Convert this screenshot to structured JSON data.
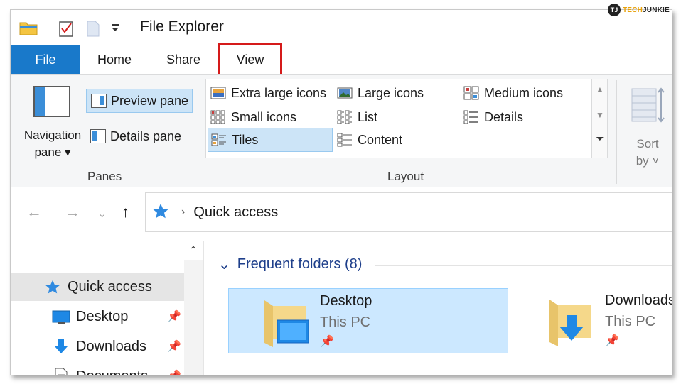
{
  "watermark": {
    "mark": "TJ",
    "brand_pre": "TECH",
    "brand_post": "JUNKIE"
  },
  "window": {
    "title": "File Explorer"
  },
  "tabs": {
    "file": "File",
    "home": "Home",
    "share": "Share",
    "view": "View"
  },
  "ribbon": {
    "panes": {
      "navigation_pane_line1": "Navigation",
      "navigation_pane_line2": "pane ▾",
      "preview_pane": "Preview pane",
      "details_pane": "Details pane",
      "group_label": "Panes"
    },
    "layout": {
      "extra_large_icons": "Extra large icons",
      "large_icons": "Large icons",
      "medium_icons": "Medium icons",
      "small_icons": "Small icons",
      "list": "List",
      "details": "Details",
      "tiles": "Tiles",
      "content": "Content",
      "group_label": "Layout",
      "selected": "Tiles"
    },
    "sort": {
      "line1": "Sort",
      "line2": "by ˅"
    }
  },
  "address": {
    "location": "Quick access"
  },
  "sidebar": {
    "items": [
      {
        "label": "Quick access",
        "icon": "star-icon",
        "pinned": false,
        "selected": true
      },
      {
        "label": "Desktop",
        "icon": "desktop-icon",
        "pinned": true
      },
      {
        "label": "Downloads",
        "icon": "download-icon",
        "pinned": true
      },
      {
        "label": "Documents",
        "icon": "document-icon",
        "pinned": true
      }
    ]
  },
  "content": {
    "section_title": "Frequent folders (8)",
    "folders": [
      {
        "name": "Desktop",
        "location": "This PC",
        "selected": true
      },
      {
        "name": "Downloads",
        "location": "This PC",
        "selected": false
      }
    ]
  },
  "colors": {
    "accent": "#1979ca",
    "highlight_border": "#d51a1a",
    "selection": "#cce8ff",
    "section_title": "#1e3f8b"
  }
}
